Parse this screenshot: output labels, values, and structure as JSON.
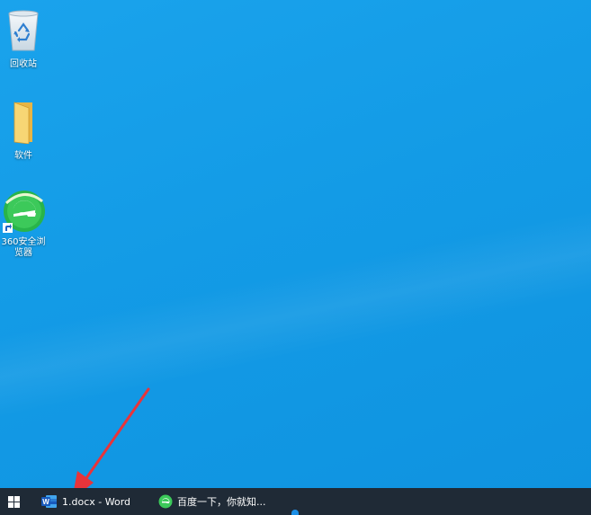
{
  "desktop": {
    "icons": [
      {
        "label": "回收站",
        "icon": "recycle-bin-icon"
      },
      {
        "label": "软件",
        "icon": "folder-icon"
      },
      {
        "label": "360安全浏览器",
        "icon": "360-browser-icon"
      }
    ]
  },
  "taskbar": {
    "start_icon": "windows-start-icon",
    "items": [
      {
        "label": "1.docx - Word",
        "icon": "word-icon"
      },
      {
        "label": "百度一下，你就知...",
        "icon": "360-browser-icon"
      }
    ]
  },
  "colors": {
    "desktop_bg": "#139be6",
    "taskbar_bg": "#1f2a36",
    "annotation_arrow": "#e8343a"
  }
}
